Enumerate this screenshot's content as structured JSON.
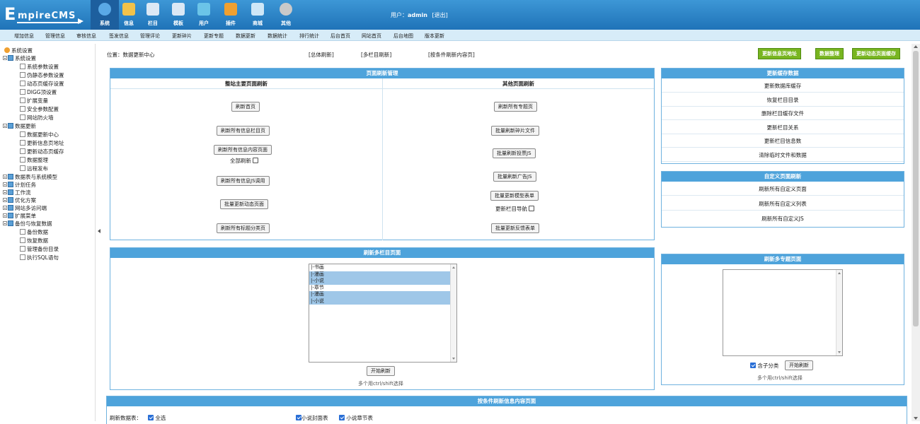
{
  "app": {
    "logo_first": "E",
    "logo_rest": "mpireCMS"
  },
  "top_menu": [
    {
      "label": "系统",
      "icon": "globe-icon",
      "color": "#5aa9e6"
    },
    {
      "label": "信息",
      "icon": "edit-icon",
      "color": "#f2c24a"
    },
    {
      "label": "栏目",
      "icon": "folder-icon",
      "color": "#dbe8f5"
    },
    {
      "label": "模板",
      "icon": "template-icon",
      "color": "#dbe8f5"
    },
    {
      "label": "用户",
      "icon": "user-icon",
      "color": "#6bc4e8"
    },
    {
      "label": "插件",
      "icon": "tools-icon",
      "color": "#f0a030"
    },
    {
      "label": "商城",
      "icon": "shop-icon",
      "color": "#cfe7f7"
    },
    {
      "label": "其他",
      "icon": "gear-icon",
      "color": "#c9c9c9"
    }
  ],
  "user": {
    "prefix": "用户：",
    "name": "admin",
    "logout": "[退出]"
  },
  "sub_menu": [
    "增加信息",
    "管理信息",
    "审核信息",
    "签发信息",
    "管理评论",
    "更新碎片",
    "更新专题",
    "数据更新",
    "数据统计",
    "排行统计",
    "后台首页",
    "网站首页",
    "后台地图",
    "版本更新"
  ],
  "sidebar": {
    "root": "系统设置",
    "group1": "系统设置",
    "group1_items": [
      "系统参数设置",
      "伪静态参数设置",
      "动态页缓存设置",
      "DIGG顶设置",
      "扩展变量",
      "安全参数配置",
      "网站防火墙"
    ],
    "group2": "数据更新",
    "group2_items": [
      "数据更新中心",
      "更新信息页地址",
      "更新动态页缓存",
      "数据整理",
      "远程发布"
    ],
    "collapsed": [
      "数据表与系统模型",
      "计划任务",
      "工作流",
      "优化方案",
      "网站多访问端",
      "扩展菜单"
    ],
    "group3": "备份与恢复数据",
    "group3_items": [
      "备份数据",
      "恢复数据",
      "管理备份目录",
      "执行SQL语句"
    ]
  },
  "main": {
    "location": "位置：数据更新中心",
    "top_links": [
      "[总体刷新]",
      "[多栏目刷新]",
      "[按条件刷新内容页]"
    ],
    "top_buttons": [
      "更新信息页地址",
      "数据整理",
      "更新动态页面缓存"
    ],
    "page_refresh": {
      "title": "页面刷新管理",
      "left_head": "整站主要页面刷新",
      "right_head": "其他页面刷新",
      "left_buttons": [
        "刷新首页",
        "刷新所有信息栏目页",
        "刷新所有信息内容页面",
        "刷新所有信息JS调用",
        "批量更新动态页面",
        "刷新所有标题分类页"
      ],
      "left_check": "全部刷新",
      "right_buttons": [
        "刷新所有专题页",
        "批量刷新碎片文件",
        "批量刷新投票JS",
        "批量刷新广告JS",
        "批量更新模型表单",
        "批量更新反馈表单"
      ],
      "right_check": "更新栏目导航"
    },
    "cache": {
      "title": "更新缓存数据",
      "items": [
        "更新数据库缓存",
        "恢复栏目目录",
        "删除栏目缓存文件",
        "更新栏目关系",
        "更新栏目信息数",
        "清除临时文件和数据"
      ]
    },
    "custom": {
      "title": "自定义页面刷新",
      "items": [
        "刷新所有自定义页面",
        "刷新所有自定义列表",
        "刷新所有自定义JS"
      ]
    },
    "multi_col": {
      "title": "刷新多栏目页面",
      "list": [
        {
          "label": "|-书画",
          "sel": false
        },
        {
          "label": "|-漫画",
          "sel": true
        },
        {
          "label": "|-小说",
          "sel": true
        },
        {
          "label": "|-章节",
          "sel": false
        },
        {
          "label": "|-漫画",
          "sel": true
        },
        {
          "label": "|-小说",
          "sel": true
        }
      ],
      "button": "开始刷新",
      "hint": "多个用ctrl/shift选择"
    },
    "multi_topic": {
      "title": "刷新多专题页面",
      "check": "含子分类",
      "button": "开始刷新",
      "hint": "多个用ctrl/shift选择"
    },
    "cond": {
      "title": "按条件刷新信息内容页面",
      "label": "刷新数据表：",
      "all": "全选",
      "tables": [
        "小说封面表",
        "小说章节表"
      ]
    }
  }
}
